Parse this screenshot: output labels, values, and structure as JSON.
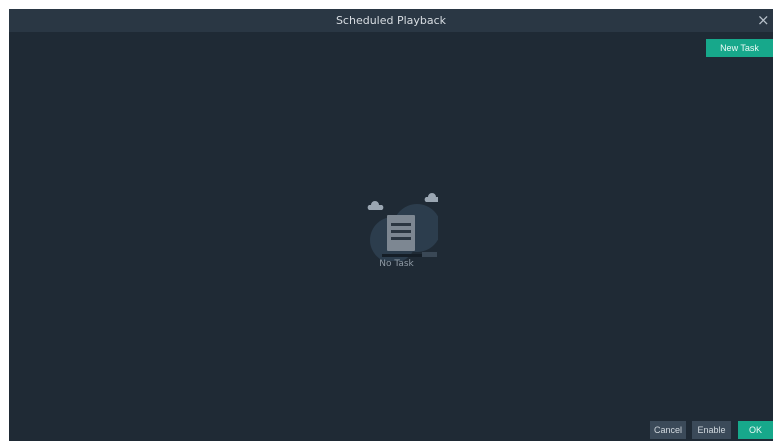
{
  "dialog": {
    "title": "Scheduled Playback",
    "close_symbol": "×"
  },
  "toolbar": {
    "new_task_label": "New Task"
  },
  "empty_state": {
    "icon": "document-with-clouds-icon",
    "message": "No Task"
  },
  "footer": {
    "cancel_label": "Cancel",
    "enable_label": "Enable",
    "ok_label": "OK"
  },
  "colors": {
    "background": "#1f2a35",
    "titlebar": "#2a3744",
    "accent": "#17a88b",
    "secondary_button": "#3b4a59"
  }
}
